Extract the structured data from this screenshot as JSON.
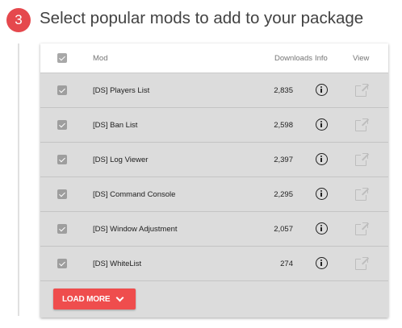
{
  "step": {
    "number": "3",
    "title": "Select popular mods to add to your package",
    "accent_color": "#e5484d"
  },
  "table": {
    "headers": {
      "mod": "Mod",
      "downloads": "Downloads",
      "info": "Info",
      "view": "View"
    },
    "select_all_checked": true,
    "rows": [
      {
        "name": "[DS] Players List",
        "downloads": "2,835",
        "checked": true
      },
      {
        "name": "[DS] Ban List",
        "downloads": "2,598",
        "checked": true
      },
      {
        "name": "[DS] Log Viewer",
        "downloads": "2,397",
        "checked": true
      },
      {
        "name": "[DS] Command Console",
        "downloads": "2,295",
        "checked": true
      },
      {
        "name": "[DS] Window Adjustment",
        "downloads": "2,057",
        "checked": true
      },
      {
        "name": "[DS] WhiteList",
        "downloads": "274",
        "checked": true
      }
    ],
    "info_icon": "info-circle-icon",
    "view_icon": "open-in-new-icon"
  },
  "load_more": {
    "label": "LOAD MORE",
    "icon": "chevron-down-icon",
    "color": "#ef4d4d"
  }
}
